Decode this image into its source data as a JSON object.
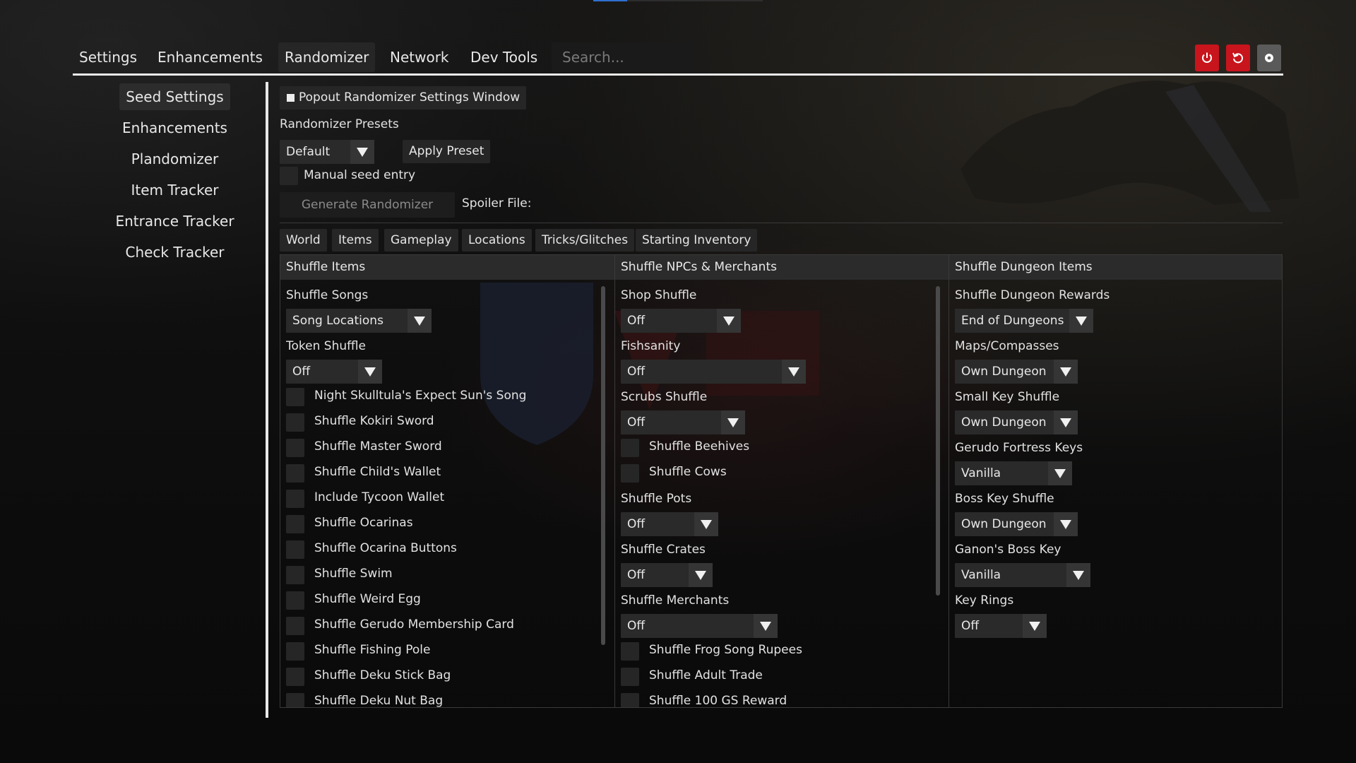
{
  "menu": {
    "items": [
      "Settings",
      "Enhancements",
      "Randomizer",
      "Network",
      "Dev Tools"
    ],
    "active_index": 2,
    "search_placeholder": "Search...",
    "buttons": {
      "power": "power-icon",
      "reset": "reset-icon",
      "settings": "settings-icon"
    }
  },
  "sidebar": {
    "items": [
      "Seed Settings",
      "Enhancements",
      "Plandomizer",
      "Item Tracker",
      "Entrance Tracker",
      "Check Tracker"
    ],
    "active_index": 0
  },
  "main": {
    "popout_label": "Popout Randomizer Settings Window",
    "presets_label": "Randomizer Presets",
    "preset_value": "Default",
    "apply_preset": "Apply Preset",
    "manual_seed": "Manual seed entry",
    "generate": "Generate Randomizer",
    "spoiler": "Spoiler File:",
    "tabs": [
      "World",
      "Items",
      "Gameplay",
      "Locations",
      "Tricks/Glitches",
      "Starting Inventory"
    ]
  },
  "columns": [
    {
      "header": "Shuffle Items"
    },
    {
      "header": "Shuffle NPCs & Merchants"
    },
    {
      "header": "Shuffle Dungeon Items"
    }
  ],
  "col1": {
    "songs_label": "Shuffle Songs",
    "songs_value": "Song Locations",
    "token_label": "Token Shuffle",
    "token_value": "Off",
    "checks": [
      "Night Skulltula's Expect Sun's Song",
      "Shuffle Kokiri Sword",
      "Shuffle Master Sword",
      "Shuffle Child's Wallet",
      "Include Tycoon Wallet",
      "Shuffle Ocarinas",
      "Shuffle Ocarina Buttons",
      "Shuffle Swim",
      "Shuffle Weird Egg",
      "Shuffle Gerudo Membership Card",
      "Shuffle Fishing Pole",
      "Shuffle Deku Stick Bag",
      "Shuffle Deku Nut Bag"
    ]
  },
  "col2": {
    "shop_label": "Shop Shuffle",
    "shop_value": "Off",
    "fish_label": "Fishsanity",
    "fish_value": "Off",
    "scrubs_label": "Scrubs Shuffle",
    "scrubs_value": "Off",
    "beehives": "Shuffle Beehives",
    "cows": "Shuffle Cows",
    "pots_label": "Shuffle Pots",
    "pots_value": "Off",
    "crates_label": "Shuffle Crates",
    "crates_value": "Off",
    "merchants_label": "Shuffle Merchants",
    "merchants_value": "Off",
    "frog": "Shuffle Frog Song Rupees",
    "adult_trade": "Shuffle Adult Trade",
    "gs_reward": "Shuffle 100 GS Reward"
  },
  "col3": {
    "rewards_label": "Shuffle Dungeon Rewards",
    "rewards_value": "End of Dungeons",
    "maps_label": "Maps/Compasses",
    "maps_value": "Own Dungeon",
    "smallkey_label": "Small Key Shuffle",
    "smallkey_value": "Own Dungeon",
    "gerudo_label": "Gerudo Fortress Keys",
    "gerudo_value": "Vanilla",
    "bosskey_label": "Boss Key Shuffle",
    "bosskey_value": "Own Dungeon",
    "ganon_label": "Ganon's Boss Key",
    "ganon_value": "Vanilla",
    "keyrings_label": "Key Rings",
    "keyrings_value": "Off"
  }
}
